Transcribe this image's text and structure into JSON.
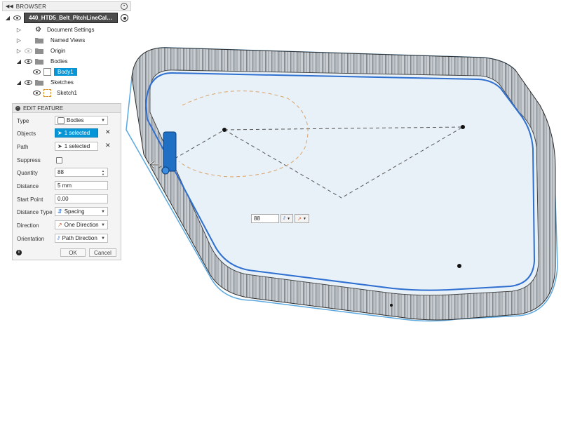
{
  "browser": {
    "title": "BROWSER",
    "document_name": "440_HTD5_Belt_PitchLineCalc...",
    "items": [
      {
        "label": "Document Settings",
        "icon": "gear-icon"
      },
      {
        "label": "Named Views",
        "icon": "folder-icon"
      },
      {
        "label": "Origin",
        "icon": "folder-icon"
      },
      {
        "label": "Bodies",
        "icon": "folder-icon"
      },
      {
        "label": "Body1",
        "icon": "body-icon"
      },
      {
        "label": "Sketches",
        "icon": "folder-icon"
      },
      {
        "label": "Sketch1",
        "icon": "sketch-icon"
      }
    ]
  },
  "edit_feature": {
    "title": "EDIT FEATURE",
    "type": {
      "label": "Type",
      "value": "Bodies"
    },
    "objects": {
      "label": "Objects",
      "value": "1 selected"
    },
    "path": {
      "label": "Path",
      "value": "1 selected"
    },
    "suppress": {
      "label": "Suppress",
      "checked": false
    },
    "quantity": {
      "label": "Quantity",
      "value": "88"
    },
    "distance": {
      "label": "Distance",
      "value": "5 mm"
    },
    "start_point": {
      "label": "Start Point",
      "value": "0.00"
    },
    "distance_type": {
      "label": "Distance Type",
      "value": "Spacing"
    },
    "direction": {
      "label": "Direction",
      "value": "One Direction"
    },
    "orientation": {
      "label": "Orientation",
      "value": "Path Direction"
    },
    "ok_label": "OK",
    "cancel_label": "Cancel"
  },
  "viewport": {
    "quantity_input": "88"
  },
  "colors": {
    "accent": "#0696d7",
    "belt_fill": "#e8f1f8",
    "path": "#2f6fd0",
    "selected_body": "#1f6fc5"
  }
}
